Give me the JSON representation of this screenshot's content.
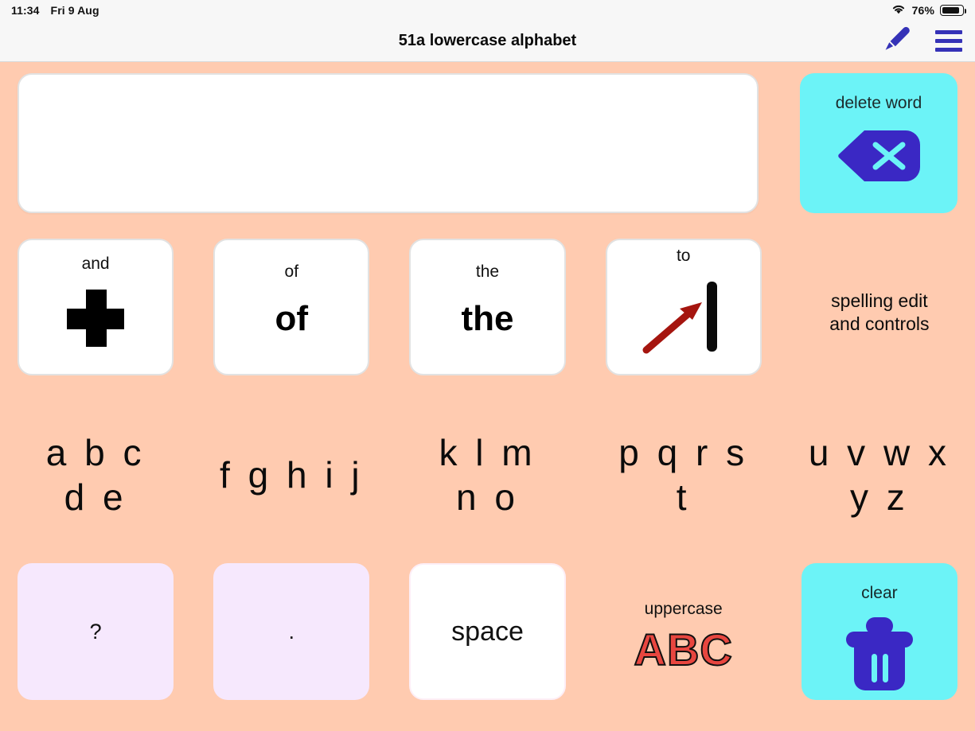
{
  "status_bar": {
    "time": "11:34",
    "date": "Fri 9 Aug",
    "wifi_icon": "wifi-icon",
    "battery_percent": "76%",
    "battery_icon": "battery-icon"
  },
  "title_bar": {
    "title": "51a lowercase alphabet",
    "edit_icon": "pencil-icon",
    "menu_icon": "hamburger-menu-icon",
    "accent_color": "#3532b7"
  },
  "text_display": {
    "value": "",
    "placeholder": ""
  },
  "delete_word": {
    "label": "delete word",
    "icon": "backspace-delete-icon",
    "bg_color": "#6cf3f7",
    "icon_color": "#3a28c4"
  },
  "rows": {
    "words": [
      {
        "name": "and",
        "top_label": "and",
        "symbol": "plus-icon",
        "big_text": "",
        "bg_color": "#ffffff"
      },
      {
        "name": "of",
        "top_label": "of",
        "symbol": "",
        "big_text": "of",
        "bg_color": "#ffffff"
      },
      {
        "name": "the",
        "top_label": "the",
        "symbol": "",
        "big_text": "the",
        "bg_color": "#ffffff"
      },
      {
        "name": "to",
        "top_label": "to",
        "symbol": "arrow-to-bar-icon",
        "big_text": "",
        "bg_color": "#ffffff"
      },
      {
        "name": "spelling-edit-and-controls",
        "folder": true,
        "label_line1": "spelling edit",
        "label_line2": "and controls",
        "bg_color": "#b768f7"
      }
    ],
    "alphabet": [
      {
        "name": "abcde",
        "line1": "a b c",
        "line2": "d e",
        "bg_color": "#fdf7a8"
      },
      {
        "name": "fghij",
        "line1": "f g h i j",
        "line2": "",
        "bg_color": "#b3dffd"
      },
      {
        "name": "klmno",
        "line1": "k l m",
        "line2": "n o",
        "bg_color": "#ffb3fb"
      },
      {
        "name": "pqrst",
        "line1": "p q r s t",
        "line2": "",
        "bg_color": "#b4fab4"
      },
      {
        "name": "uvwxyz",
        "line1": "u v w x",
        "line2": "y z",
        "bg_color": "#f3e7fd"
      }
    ],
    "bottom": [
      {
        "name": "question-mark",
        "text": "?",
        "bg_color": "#f6e8fd",
        "type": "punct"
      },
      {
        "name": "period",
        "text": ".",
        "bg_color": "#f6e8fd",
        "type": "punct"
      },
      {
        "name": "space",
        "text": "space",
        "bg_color": "#ffffff",
        "type": "space"
      },
      {
        "name": "uppercase",
        "label": "uppercase",
        "text": "ABC",
        "bg_color": "#07bfcc",
        "text_color": "#e8463f",
        "type": "folder"
      },
      {
        "name": "clear",
        "label": "clear",
        "icon": "trash-icon",
        "bg_color": "#6cf3f7",
        "icon_color": "#3a28c4",
        "type": "action"
      }
    ]
  },
  "theme": {
    "background": "#ffcbb0",
    "bar_background": "#f7f7f7"
  }
}
